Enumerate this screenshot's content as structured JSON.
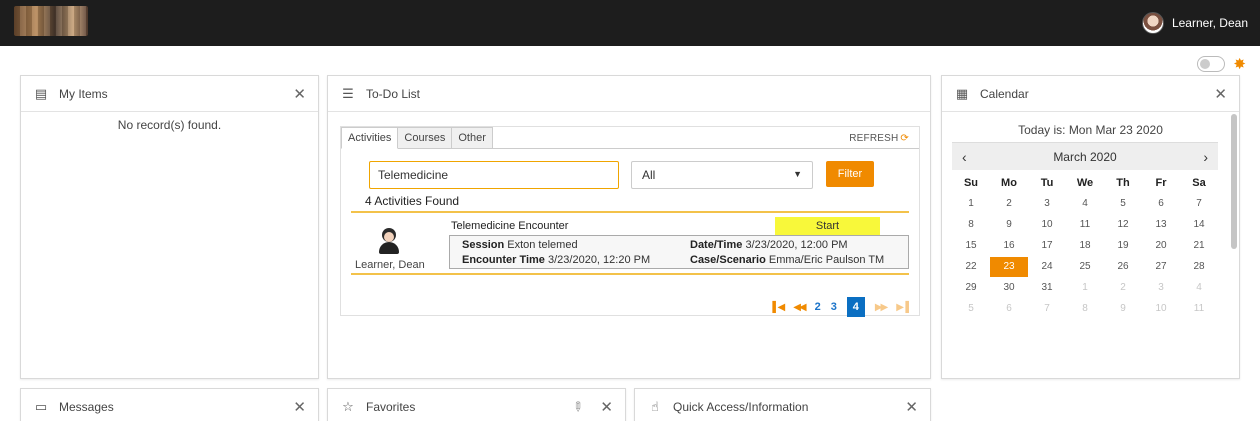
{
  "header": {
    "user_name": "Learner, Dean"
  },
  "my_items": {
    "title": "My Items",
    "empty": "No record(s) found."
  },
  "todo": {
    "title": "To-Do List",
    "tabs": [
      "Activities",
      "Courses",
      "Other"
    ],
    "refresh": "REFRESH",
    "search_value": "Telemedicine",
    "select_value": "All",
    "filter_label": "Filter",
    "found": "4 Activities Found",
    "activity": {
      "title": "Telemedicine Encounter",
      "start": "Start",
      "user": "Learner, Dean",
      "session_label": "Session",
      "session_value": "Exton telemed",
      "encounter_label": "Encounter Time",
      "encounter_value": "3/23/2020, 12:20 PM",
      "datetime_label": "Date/Time",
      "datetime_value": "3/23/2020, 12:00 PM",
      "case_label": "Case/Scenario",
      "case_value": "Emma/Eric Paulson TM"
    },
    "pager": {
      "pages": [
        "2",
        "3",
        "4"
      ],
      "active": "4"
    }
  },
  "calendar": {
    "title": "Calendar",
    "today": "Today is: Mon Mar 23 2020",
    "month": "March 2020",
    "weekdays": [
      "Su",
      "Mo",
      "Tu",
      "We",
      "Th",
      "Fr",
      "Sa"
    ],
    "weeks": [
      [
        "1",
        "2",
        "3",
        "4",
        "5",
        "6",
        "7"
      ],
      [
        "8",
        "9",
        "10",
        "11",
        "12",
        "13",
        "14"
      ],
      [
        "15",
        "16",
        "17",
        "18",
        "19",
        "20",
        "21"
      ],
      [
        "22",
        "23",
        "24",
        "25",
        "26",
        "27",
        "28"
      ],
      [
        "29",
        "30",
        "31",
        "1",
        "2",
        "3",
        "4"
      ],
      [
        "5",
        "6",
        "7",
        "8",
        "9",
        "10",
        "11"
      ]
    ],
    "selected": "23"
  },
  "messages": {
    "title": "Messages"
  },
  "favorites": {
    "title": "Favorites"
  },
  "quick_access": {
    "title": "Quick Access/Information"
  },
  "colors": {
    "accent": "#f08a00",
    "header_bg": "#1d1d1d",
    "start_bg": "#f8f83a",
    "page_active": "#0b6fc2"
  }
}
